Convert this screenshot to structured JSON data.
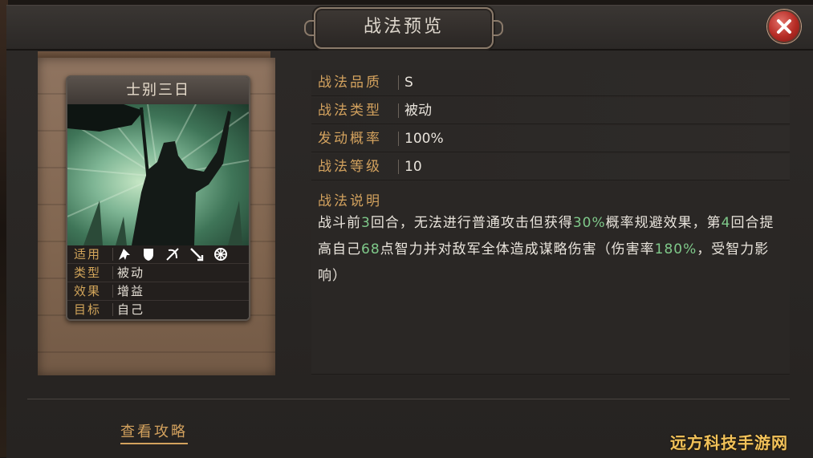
{
  "dialog": {
    "title": "战法预览"
  },
  "card": {
    "name": "士别三日",
    "stats": [
      {
        "label": "适用",
        "value": ""
      },
      {
        "label": "类型",
        "value": "被动"
      },
      {
        "label": "效果",
        "value": "增益"
      },
      {
        "label": "目标",
        "value": "自己"
      }
    ],
    "troop_icons": [
      "cavalry-icon",
      "shield-icon",
      "bow-icon",
      "spear-icon",
      "wheel-icon"
    ]
  },
  "info": {
    "rows": [
      {
        "label": "战法品质",
        "value": "S"
      },
      {
        "label": "战法类型",
        "value": "被动"
      },
      {
        "label": "发动概率",
        "value": "100%"
      },
      {
        "label": "战法等级",
        "value": "10"
      }
    ]
  },
  "description": {
    "title": "战法说明",
    "parts": [
      {
        "text": "战斗前",
        "highlight": false
      },
      {
        "text": "3",
        "highlight": true
      },
      {
        "text": "回合，无法进行普通攻击但获得",
        "highlight": false
      },
      {
        "text": "30%",
        "highlight": true
      },
      {
        "text": "概率规避效果，第",
        "highlight": false
      },
      {
        "text": "4",
        "highlight": true
      },
      {
        "text": "回合提高自己",
        "highlight": false
      },
      {
        "text": "68",
        "highlight": true
      },
      {
        "text": "点智力并对敌军全体造成谋略伤害（伤害率",
        "highlight": false
      },
      {
        "text": "180%",
        "highlight": true
      },
      {
        "text": "，受智力影响）",
        "highlight": false
      }
    ]
  },
  "footer": {
    "guide_link": "查看攻略"
  },
  "watermark": "远方科技手游网",
  "colors": {
    "label": "#d3a25e",
    "highlight": "#7fc98a",
    "close": "#b52b24"
  }
}
